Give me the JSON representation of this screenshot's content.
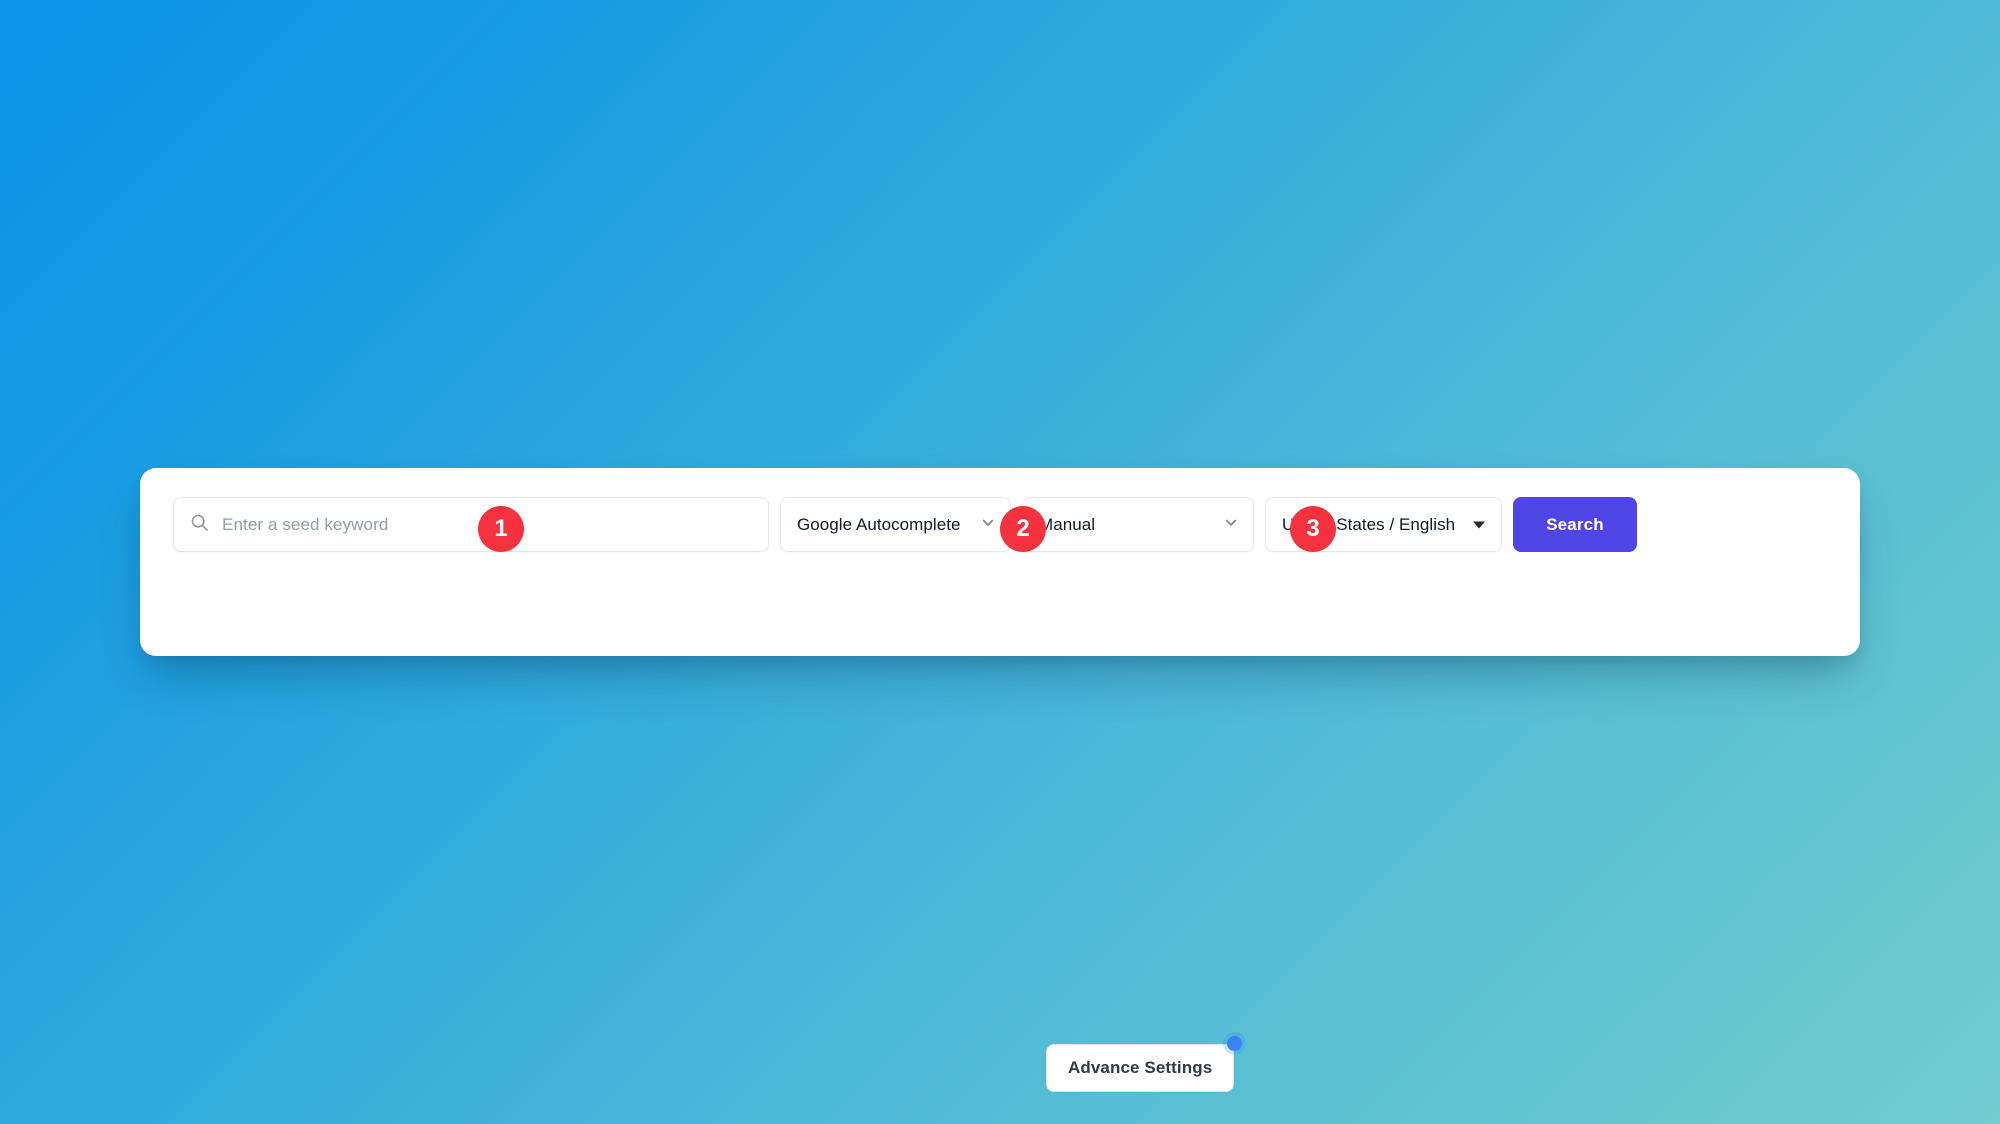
{
  "background": {
    "gradient_from": "#0a93e7",
    "gradient_to": "#71cdce"
  },
  "search_card": {
    "seed_keyword": {
      "icon": "search-icon",
      "placeholder": "Enter a seed keyword",
      "value": ""
    },
    "source_select": {
      "value": "Google Autocomplete",
      "icon": "chevron-down-icon"
    },
    "mode_select": {
      "value": "Manual",
      "icon": "chevron-down-icon"
    },
    "locale_select": {
      "value": "United States / English",
      "icon": "caret-down-icon"
    },
    "search_button": {
      "label": "Search",
      "color": "#4f46e5"
    },
    "advance_settings": {
      "label": "Advance Settings",
      "badge_dot_color": "#3b82f6"
    }
  },
  "step_badges": {
    "color": "#f6323f",
    "items": [
      {
        "number": "1",
        "target": "seed-keyword-input"
      },
      {
        "number": "2",
        "target": "source-select"
      },
      {
        "number": "3",
        "target": "mode-select"
      }
    ]
  }
}
